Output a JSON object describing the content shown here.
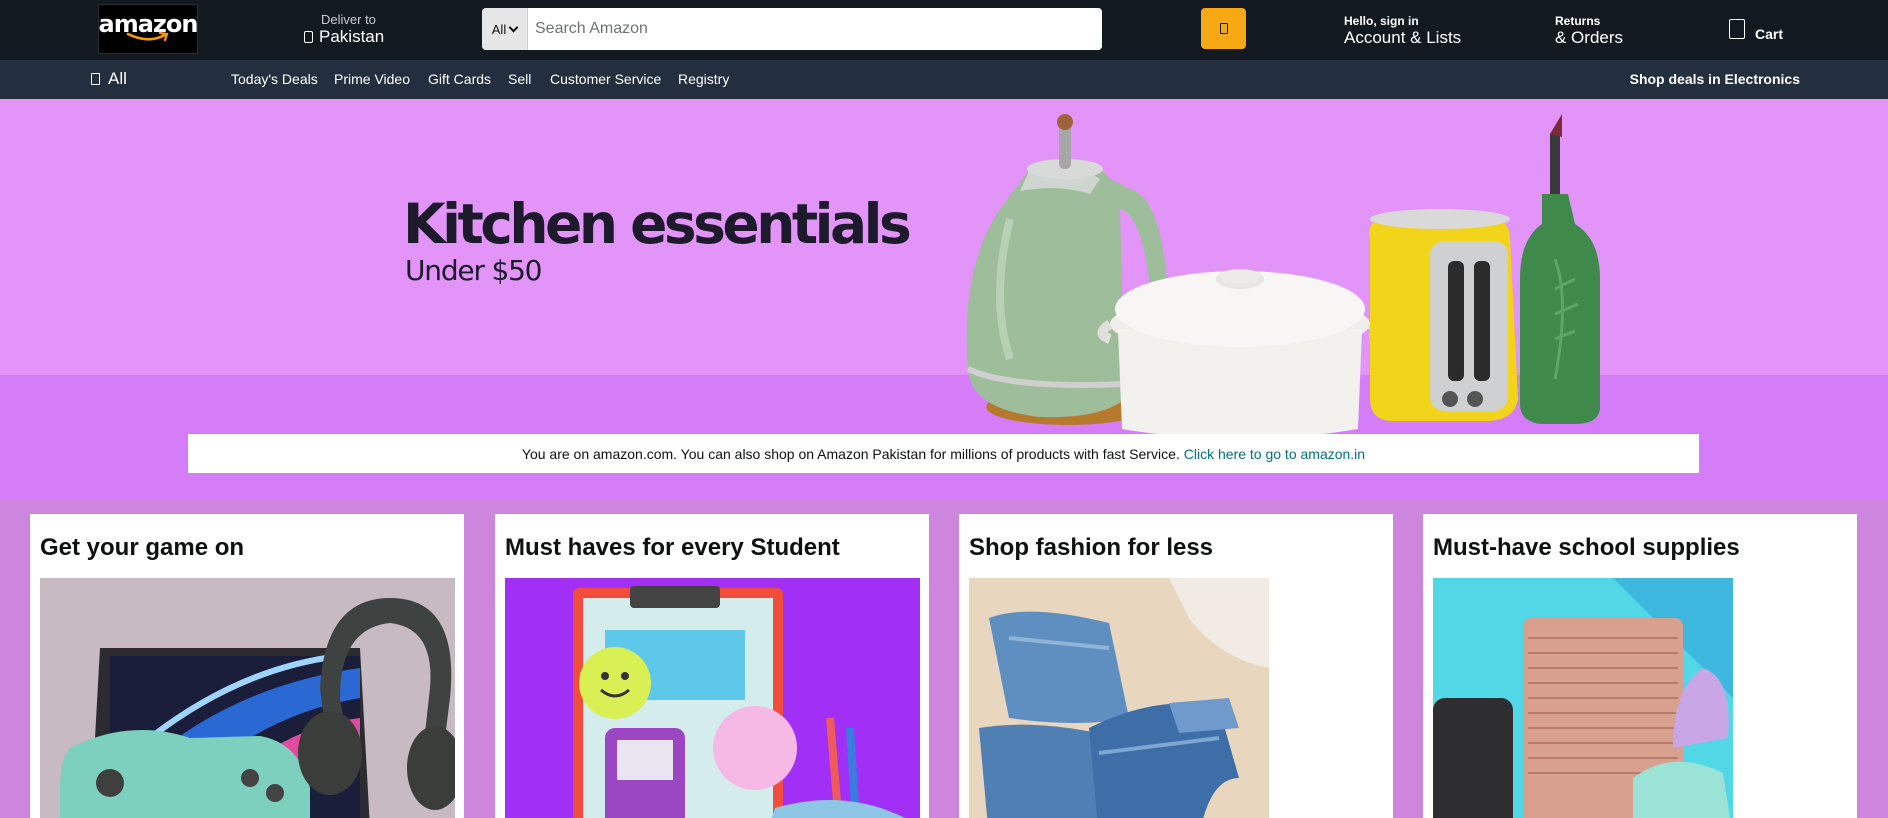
{
  "logo": {
    "text": "amazon"
  },
  "deliver": {
    "line1": "Deliver to",
    "line2": "Pakistan",
    "icon": "location-pin-icon"
  },
  "search": {
    "category": "All",
    "placeholder": "Search Amazon",
    "value": "",
    "button_icon": "search-icon"
  },
  "account": {
    "line1": "Hello, sign in",
    "line2": "Account & Lists"
  },
  "returns": {
    "line1": "Returns",
    "line2": "& Orders"
  },
  "cart": {
    "label": "Cart",
    "icon": "cart-icon"
  },
  "subnav": {
    "all_label": "All",
    "items": [
      "Today's Deals",
      "Prime Video",
      "Gift Cards",
      "Sell",
      "Customer Service",
      "Registry"
    ],
    "promo": "Shop deals in Electronics"
  },
  "hero": {
    "title": "Kitchen essentials",
    "subtitle": "Under $50",
    "notice_text": "You are on amazon.com. You can also shop on Amazon Pakistan for millions of products with fast Service.",
    "notice_link": "Click here to go to amazon.in"
  },
  "cards": [
    {
      "title": "Get your game on"
    },
    {
      "title": "Must haves for every Student"
    },
    {
      "title": "Shop fashion for less"
    },
    {
      "title": "Must-have school supplies"
    }
  ],
  "colors": {
    "nav_bg": "#131921",
    "subnav_bg": "#232f3e",
    "search_button": "#f7a915",
    "link": "#007185",
    "hero_bg": "#e294f9",
    "page_bg": "#cd85dd"
  }
}
